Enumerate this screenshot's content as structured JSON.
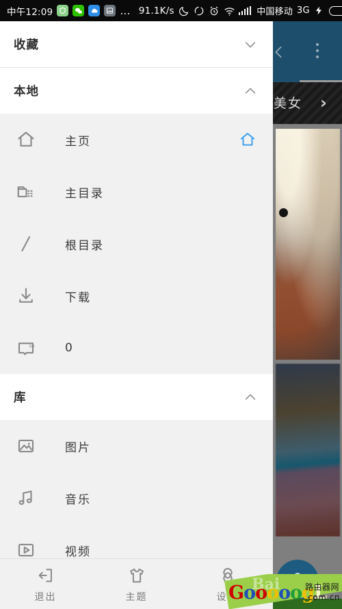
{
  "statusbar": {
    "clock": "中午12:09",
    "app_icons": [
      "shield-app-icon",
      "wechat-app-icon",
      "cloud-app-icon",
      "photo-app-icon"
    ],
    "overflow": "…",
    "network_speed": "91.1K/s",
    "indicators": [
      "moon-icon",
      "sync-circle-icon",
      "alarm-clock-icon",
      "wifi-icon",
      "signal-bars-icon"
    ],
    "carrier": "中国移动",
    "network_type": "3G",
    "charging": "charging-bolt-icon",
    "battery": "battery-icon"
  },
  "drawer": {
    "sections": [
      {
        "title": "收藏",
        "chevron": "chevron-down-icon",
        "expanded": false,
        "items": []
      },
      {
        "title": "本地",
        "chevron": "chevron-up-icon",
        "expanded": true,
        "items": [
          {
            "label": "主页",
            "icon": "home-icon",
            "right_icon": "home-icon-blue"
          },
          {
            "label": "主目录",
            "icon": "folder-list-icon",
            "right_icon": ""
          },
          {
            "label": "根目录",
            "icon": "slash-icon",
            "right_icon": ""
          },
          {
            "label": "下载",
            "icon": "download-icon",
            "right_icon": ""
          },
          {
            "label": "0",
            "icon": "sd-card-icon",
            "right_icon": ""
          }
        ]
      },
      {
        "title": "库",
        "chevron": "chevron-up-icon",
        "expanded": true,
        "items": [
          {
            "label": "图片",
            "icon": "image-icon",
            "right_icon": ""
          },
          {
            "label": "音乐",
            "icon": "music-note-icon",
            "right_icon": ""
          },
          {
            "label": "视频",
            "icon": "video-play-icon",
            "right_icon": ""
          }
        ]
      }
    ]
  },
  "bottom_nav": [
    {
      "label": "退出",
      "icon": "exit-icon"
    },
    {
      "label": "主题",
      "icon": "tshirt-icon"
    },
    {
      "label": "设置",
      "icon": "gear-icon"
    }
  ],
  "content": {
    "back": "chevron-left-icon",
    "menu": "kebab-menu-icon",
    "band_label": "美女",
    "band_chevron": "chevron-right-icon",
    "fab": "lock-icon"
  },
  "watermark": {
    "letters": [
      {
        "ch": "G",
        "cls": "c1"
      },
      {
        "ch": "o",
        "cls": "c2"
      },
      {
        "ch": "o",
        "cls": "c1"
      },
      {
        "ch": "o",
        "cls": "c3"
      },
      {
        "ch": "o",
        "cls": "c2"
      },
      {
        "ch": "o",
        "cls": "c4"
      },
      {
        "ch": "g",
        "cls": "c3"
      },
      {
        "ch": "L",
        "cls": "c5"
      }
    ],
    "cn_text": "路由器网",
    "domain_text": ".com.cn",
    "ghost_text": "Bai"
  },
  "colors": {
    "accent_blue": "#3aa0f0",
    "header_blue": "#1d4e6b",
    "fab_blue": "#1d5c80",
    "drawer_bg": "#f1f1f1",
    "section_bg": "#ffffff",
    "icon_gray": "#8a8a8a",
    "text_gray": "#7c7c7c"
  }
}
